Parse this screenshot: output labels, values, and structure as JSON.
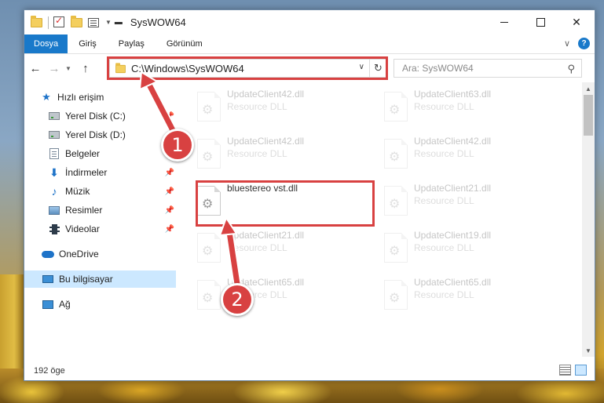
{
  "window": {
    "title": "SysWOW64"
  },
  "ribbon": {
    "tabs": [
      "Dosya",
      "Giriş",
      "Paylaş",
      "Görünüm"
    ],
    "help": "?"
  },
  "nav": {
    "back": "←",
    "forward": "→",
    "up": "↑",
    "address": "C:\\Windows\\SysWOW64",
    "search_placeholder": "Ara: SysWOW64"
  },
  "sidebar": {
    "items": [
      {
        "label": "Hızlı erişim",
        "icon": "star-icon"
      },
      {
        "label": "Yerel Disk (C:)",
        "icon": "drive-icon",
        "pinned": true
      },
      {
        "label": "Yerel Disk (D:)",
        "icon": "drive-icon"
      },
      {
        "label": "Belgeler",
        "icon": "documents-icon"
      },
      {
        "label": "İndirmeler",
        "icon": "download-icon",
        "pinned": true
      },
      {
        "label": "Müzik",
        "icon": "music-icon",
        "pinned": true
      },
      {
        "label": "Resimler",
        "icon": "pictures-icon",
        "pinned": true
      },
      {
        "label": "Videolar",
        "icon": "video-icon",
        "pinned": true
      },
      {
        "label": "OneDrive",
        "icon": "cloud-icon"
      },
      {
        "label": "Bu bilgisayar",
        "icon": "computer-icon",
        "selected": true
      },
      {
        "label": "Ağ",
        "icon": "network-icon"
      }
    ]
  },
  "files": [
    {
      "name": "UpdateClient42.dll",
      "type": "Resource DLL"
    },
    {
      "name": "UpdateClient63.dll",
      "type": "Resource DLL"
    },
    {
      "name": "UpdateClient42.dll",
      "type": "Resource DLL"
    },
    {
      "name": "UpdateClient42.dll",
      "type": "Resource DLL"
    },
    {
      "name": "bluestereo vst.dll",
      "type": ""
    },
    {
      "name": "UpdateClient21.dll",
      "type": "Resource DLL"
    },
    {
      "name": "UpdateClient21.dll",
      "type": "Resource DLL"
    },
    {
      "name": "UpdateClient19.dll",
      "type": "Resource DLL"
    },
    {
      "name": "UpdateClient65.dll",
      "type": "Resource DLL"
    },
    {
      "name": "UpdateClient65.dll",
      "type": "Resource DLL"
    }
  ],
  "callouts": [
    "1",
    "2"
  ],
  "status": {
    "count": "192 öge"
  },
  "colors": {
    "accent": "#1979ca",
    "highlight": "#d84141",
    "selected": "#cce8ff"
  }
}
